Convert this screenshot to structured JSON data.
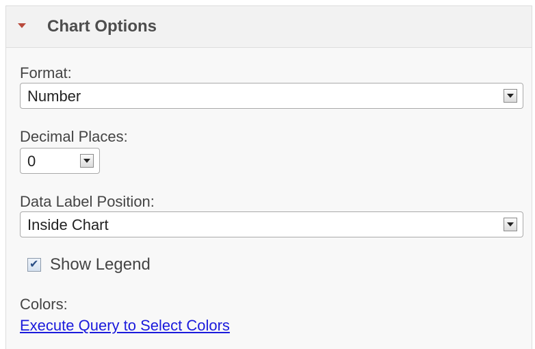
{
  "panel": {
    "title": "Chart Options",
    "expanded": true,
    "accent_color": "#b94a3c"
  },
  "format": {
    "label": "Format:",
    "value": "Number"
  },
  "decimal_places": {
    "label": "Decimal Places:",
    "value": "0"
  },
  "data_label_position": {
    "label": "Data Label Position:",
    "value": "Inside Chart"
  },
  "show_legend": {
    "label": "Show Legend",
    "checked": true
  },
  "colors": {
    "label": "Colors:",
    "link_text": "Execute Query to Select Colors"
  }
}
